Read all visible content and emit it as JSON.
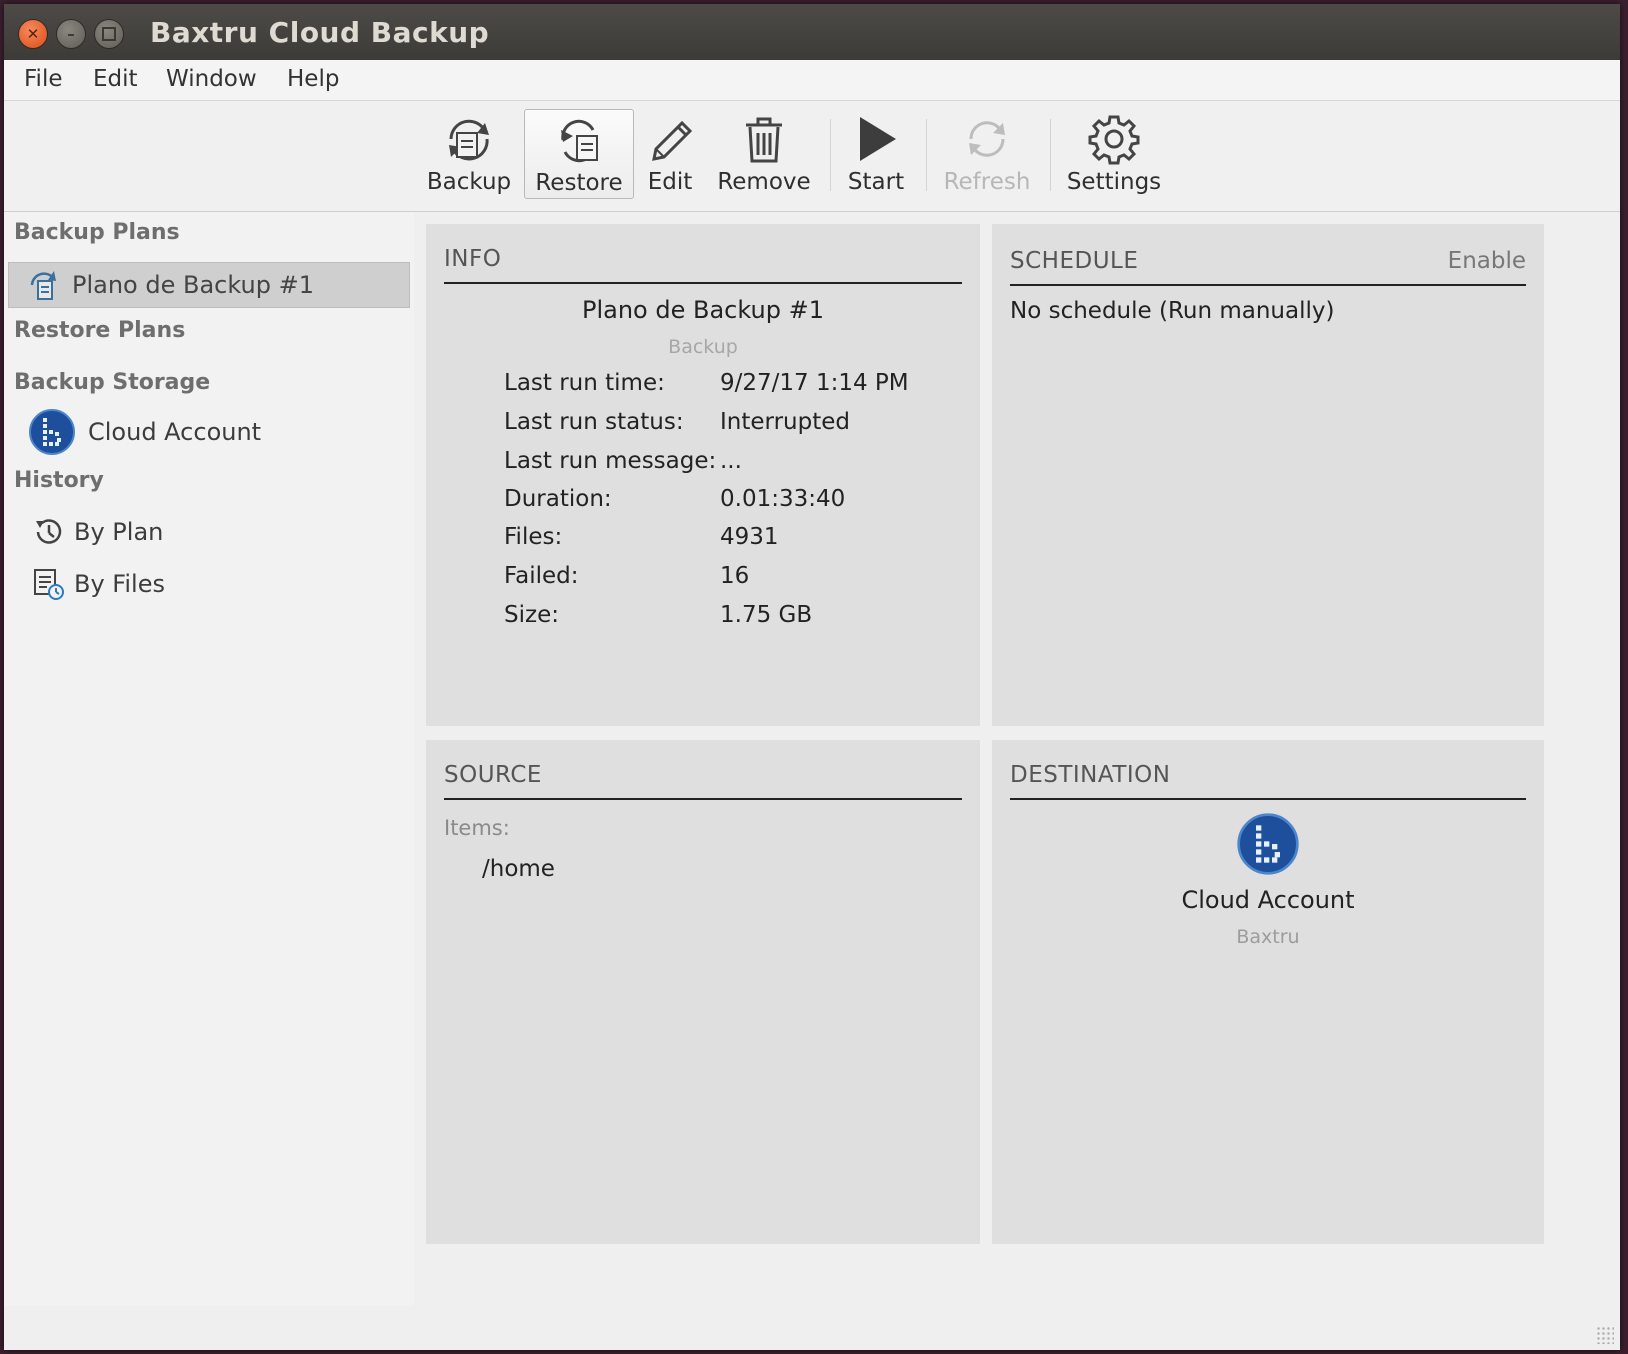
{
  "window": {
    "title": "Baxtru Cloud Backup"
  },
  "menu": [
    "File",
    "Edit",
    "Window",
    "Help"
  ],
  "toolbar": {
    "backup": "Backup",
    "restore": "Restore",
    "edit": "Edit",
    "remove": "Remove",
    "start": "Start",
    "refresh": "Refresh",
    "settings": "Settings"
  },
  "sidebar": {
    "backup_plans_header": "Backup Plans",
    "backup_plan_item": "Plano de Backup #1",
    "restore_plans_header": "Restore Plans",
    "backup_storage_header": "Backup Storage",
    "cloud_account_item": "Cloud Account",
    "history_header": "History",
    "by_plan": "By Plan",
    "by_files": "By Files"
  },
  "info": {
    "header": "INFO",
    "plan_name": "Plano de Backup #1",
    "plan_type": "Backup",
    "rows": [
      {
        "label": "Last run time:",
        "value": "9/27/17 1:14 PM"
      },
      {
        "label": "Last run status:",
        "value": "Interrupted"
      },
      {
        "label": "Last run message:",
        "value": "..."
      },
      {
        "label": "Duration:",
        "value": "0.01:33:40"
      },
      {
        "label": "Files:",
        "value": "4931"
      },
      {
        "label": "Failed:",
        "value": "16"
      },
      {
        "label": "Size:",
        "value": "1.75 GB"
      }
    ]
  },
  "schedule": {
    "header": "SCHEDULE",
    "enable_link": "Enable",
    "text": "No schedule (Run manually)"
  },
  "source": {
    "header": "SOURCE",
    "items_label": "Items:",
    "items": [
      "/home"
    ]
  },
  "destination": {
    "header": "DESTINATION",
    "name": "Cloud Account",
    "provider": "Baxtru"
  },
  "colors": {
    "titlebar": "#3d3b38",
    "close_button": "#df4a16",
    "brand_blue": "#1d4f9c"
  }
}
